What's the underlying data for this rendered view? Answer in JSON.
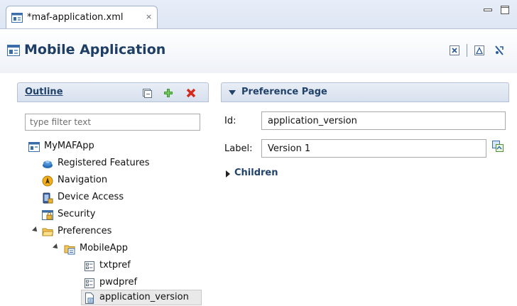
{
  "editor_tab": {
    "title": "*maf-application.xml",
    "close_glyph": "⨯"
  },
  "header": {
    "title": "Mobile Application"
  },
  "outline": {
    "title": "Outline",
    "filter_placeholder": "type filter text",
    "tree": [
      {
        "label": "MyMAFApp",
        "icon": "application-icon",
        "level": 0,
        "expanded": true
      },
      {
        "label": "Registered Features",
        "icon": "features-icon",
        "level": 1
      },
      {
        "label": "Navigation",
        "icon": "navigation-icon",
        "level": 1
      },
      {
        "label": "Device Access",
        "icon": "device-access-icon",
        "level": 1
      },
      {
        "label": "Security",
        "icon": "security-icon",
        "level": 1
      },
      {
        "label": "Preferences",
        "icon": "folder-icon",
        "level": 1,
        "expanded": true
      },
      {
        "label": "MobileApp",
        "icon": "preference-group-icon",
        "level": 2,
        "expanded": true
      },
      {
        "label": "txtpref",
        "icon": "text-preference-icon",
        "level": 3
      },
      {
        "label": "pwdpref",
        "icon": "text-preference-icon",
        "level": 3
      },
      {
        "label": "application_version",
        "icon": "preference-page-icon",
        "level": 3,
        "selected": true
      }
    ]
  },
  "preference_page": {
    "title": "Preference Page",
    "id_label": "Id:",
    "id_value": "application_version",
    "label_label": "Label:",
    "label_value": "Version 1",
    "children_label": "Children"
  },
  "colors": {
    "section_title": "#21426b",
    "header_title": "#1e3e66",
    "selection": "#e9e9e9"
  }
}
